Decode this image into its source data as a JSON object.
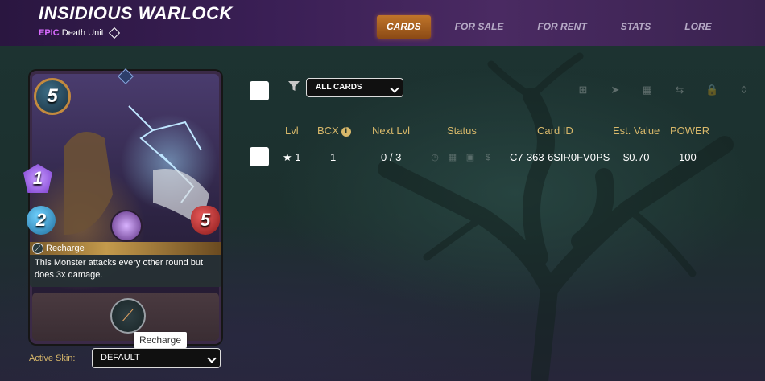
{
  "header": {
    "title": "INSIDIOUS WARLOCK",
    "rarity": "EPIC",
    "unit_type": "Death Unit",
    "tabs": [
      {
        "label": "CARDS",
        "active": true
      },
      {
        "label": "FOR SALE",
        "active": false
      },
      {
        "label": "FOR RENT",
        "active": false
      },
      {
        "label": "STATS",
        "active": false
      },
      {
        "label": "LORE",
        "active": false
      }
    ]
  },
  "card": {
    "mana": "5",
    "attack": "1",
    "speed": "2",
    "health": "5",
    "ability": {
      "name": "Recharge",
      "description": "This Monster attacks every other round but does 3x damage."
    },
    "tooltip": "Recharge"
  },
  "skin": {
    "label": "Active Skin:",
    "selected": "DEFAULT"
  },
  "filter": {
    "selected": "ALL CARDS"
  },
  "toolbar": {
    "icons": [
      "add-icon",
      "send-icon",
      "market-icon",
      "transfer-icon",
      "lock-icon",
      "burn-icon"
    ]
  },
  "table": {
    "headers": {
      "lvl": "Lvl",
      "bcx": "BCX",
      "next_lvl": "Next Lvl",
      "status": "Status",
      "card_id": "Card ID",
      "est_value": "Est. Value",
      "power": "POWER"
    },
    "rows": [
      {
        "lvl": "★ 1",
        "bcx": "1",
        "next_lvl": "0 / 3",
        "card_id": "C7-363-6SIR0FV0PS",
        "est_value": "$0.70",
        "power": "100"
      }
    ]
  },
  "colors": {
    "accent_orange": "#c0752a",
    "gold_text": "#d8b86a",
    "epic_purple": "#d96bff"
  }
}
